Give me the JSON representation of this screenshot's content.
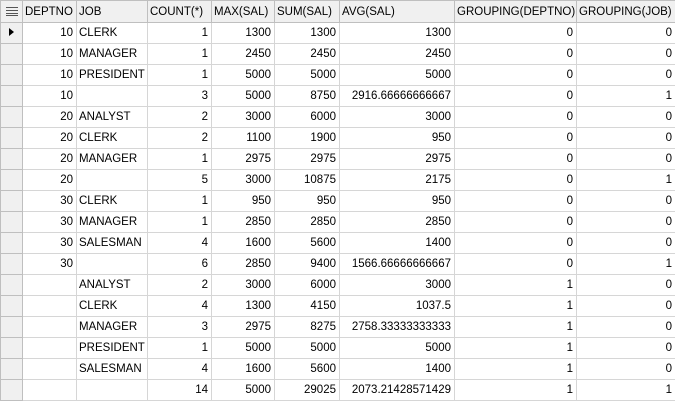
{
  "columns": [
    "DEPTNO",
    "JOB",
    "COUNT(*)",
    "MAX(SAL)",
    "SUM(SAL)",
    "AVG(SAL)",
    "GROUPING(DEPTNO)",
    "GROUPING(JOB)"
  ],
  "rows": [
    [
      "10",
      "CLERK",
      "1",
      "1300",
      "1300",
      "1300",
      "0",
      "0"
    ],
    [
      "10",
      "MANAGER",
      "1",
      "2450",
      "2450",
      "2450",
      "0",
      "0"
    ],
    [
      "10",
      "PRESIDENT",
      "1",
      "5000",
      "5000",
      "5000",
      "0",
      "0"
    ],
    [
      "10",
      "",
      "3",
      "5000",
      "8750",
      "2916.66666666667",
      "0",
      "1"
    ],
    [
      "20",
      "ANALYST",
      "2",
      "3000",
      "6000",
      "3000",
      "0",
      "0"
    ],
    [
      "20",
      "CLERK",
      "2",
      "1100",
      "1900",
      "950",
      "0",
      "0"
    ],
    [
      "20",
      "MANAGER",
      "1",
      "2975",
      "2975",
      "2975",
      "0",
      "0"
    ],
    [
      "20",
      "",
      "5",
      "3000",
      "10875",
      "2175",
      "0",
      "1"
    ],
    [
      "30",
      "CLERK",
      "1",
      "950",
      "950",
      "950",
      "0",
      "0"
    ],
    [
      "30",
      "MANAGER",
      "1",
      "2850",
      "2850",
      "2850",
      "0",
      "0"
    ],
    [
      "30",
      "SALESMAN",
      "4",
      "1600",
      "5600",
      "1400",
      "0",
      "0"
    ],
    [
      "30",
      "",
      "6",
      "2850",
      "9400",
      "1566.66666666667",
      "0",
      "1"
    ],
    [
      "",
      "ANALYST",
      "2",
      "3000",
      "6000",
      "3000",
      "1",
      "0"
    ],
    [
      "",
      "CLERK",
      "4",
      "1300",
      "4150",
      "1037.5",
      "1",
      "0"
    ],
    [
      "",
      "MANAGER",
      "3",
      "2975",
      "8275",
      "2758.33333333333",
      "1",
      "0"
    ],
    [
      "",
      "PRESIDENT",
      "1",
      "5000",
      "5000",
      "5000",
      "1",
      "0"
    ],
    [
      "",
      "SALESMAN",
      "4",
      "1600",
      "5600",
      "1400",
      "1",
      "0"
    ],
    [
      "",
      "",
      "14",
      "5000",
      "29025",
      "2073.21428571429",
      "1",
      "1"
    ]
  ],
  "current_row_index": 0,
  "icons": {
    "header": "grid-menu-icon",
    "current_row": "current-row-arrow-icon"
  },
  "colors": {
    "header_bg": "#f0f0f0",
    "grid_line": "#d6d6d6"
  }
}
